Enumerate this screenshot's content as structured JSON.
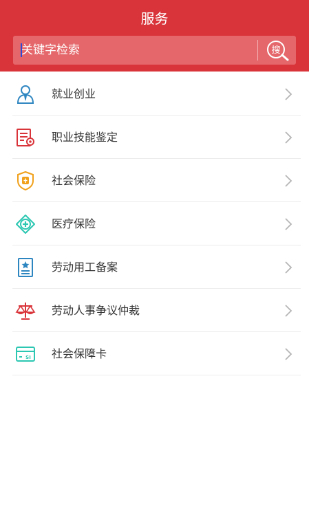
{
  "header": {
    "title": "服务",
    "search_placeholder": "关键字检索",
    "search_button_label": "搜"
  },
  "services": [
    {
      "label": "就业创业",
      "icon": "person-tie-icon"
    },
    {
      "label": "职业技能鉴定",
      "icon": "certificate-icon"
    },
    {
      "label": "社会保险",
      "icon": "shield-bao-icon"
    },
    {
      "label": "医疗保险",
      "icon": "medical-cross-icon"
    },
    {
      "label": "劳动用工备案",
      "icon": "id-card-star-icon"
    },
    {
      "label": "劳动人事争议仲裁",
      "icon": "scales-icon"
    },
    {
      "label": "社会保障卡",
      "icon": "si-card-icon"
    }
  ],
  "colors": {
    "header_red": "#d9343a",
    "search_bg": "#e5676b",
    "blue": "#2e86c1",
    "red": "#d9343a",
    "orange": "#f0a01a",
    "teal": "#2cc7b2"
  }
}
